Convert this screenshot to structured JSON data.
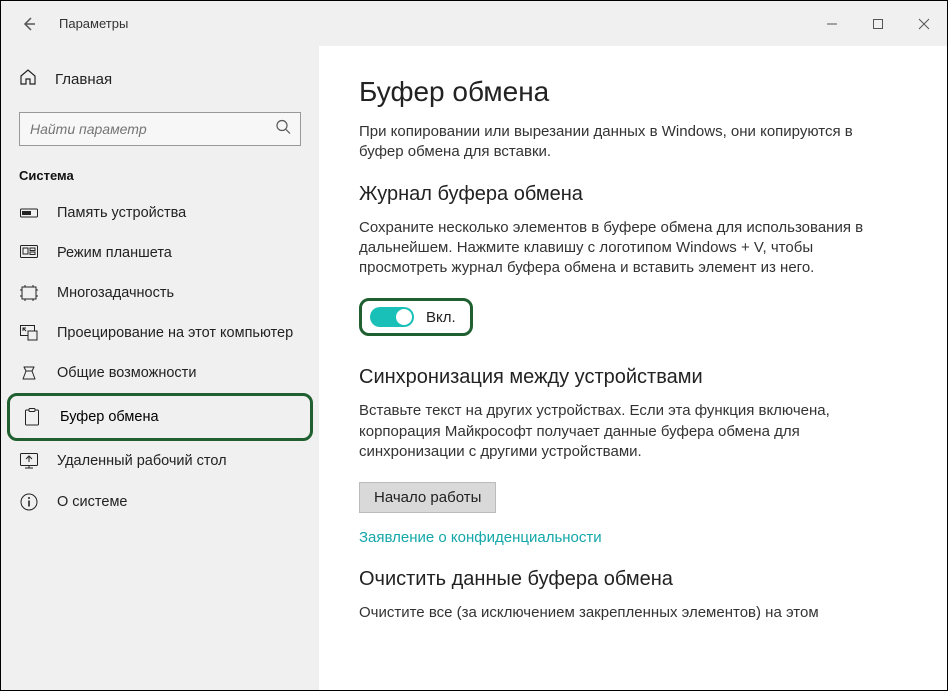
{
  "titlebar": {
    "title": "Параметры"
  },
  "sidebar": {
    "home": "Главная",
    "search_placeholder": "Найти параметр",
    "section": "Система",
    "items": [
      {
        "label": "Память устройства"
      },
      {
        "label": "Режим планшета"
      },
      {
        "label": "Многозадачность"
      },
      {
        "label": "Проецирование на этот компьютер"
      },
      {
        "label": "Общие возможности"
      },
      {
        "label": "Буфер обмена"
      },
      {
        "label": "Удаленный рабочий стол"
      },
      {
        "label": "О системе"
      }
    ]
  },
  "content": {
    "page_title": "Буфер обмена",
    "intro": "При копировании или вырезании данных в Windows, они копируются в буфер обмена для вставки.",
    "history": {
      "heading": "Журнал буфера обмена",
      "desc": "Сохраните несколько элементов в буфере обмена для использования в дальнейшем. Нажмите клавишу с логотипом Windows + V, чтобы просмотреть журнал буфера обмена и вставить элемент из него.",
      "toggle_label": "Вкл."
    },
    "sync": {
      "heading": "Синхронизация между устройствами",
      "desc": "Вставьте текст на других устройствах. Если эта функция включена, корпорация Майкрософт получает данные буфера обмена для синхронизации с другими устройствами.",
      "button": "Начало работы",
      "privacy_link": "Заявление о конфиденциальности"
    },
    "clear": {
      "heading": "Очистить данные буфера обмена",
      "desc": "Очистите все (за исключением закрепленных элементов) на этом"
    }
  }
}
